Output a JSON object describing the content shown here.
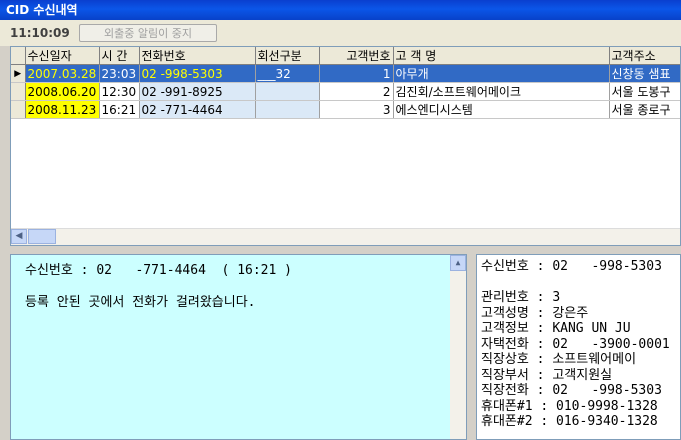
{
  "window": {
    "title": "CID 수신내역"
  },
  "toolbar": {
    "time": "11:10:09",
    "btn_label": "외출중 알림이 중지"
  },
  "grid": {
    "columns": [
      "수신일자",
      "시 간",
      "전화번호",
      "회선구분",
      "고객번호",
      "고 객 명",
      "고객주소"
    ],
    "rows": [
      {
        "date": "2007.03.28",
        "time": "23:03",
        "phone": "02   -998-5303",
        "line": "___32",
        "cust_no": "1",
        "name": "아무개",
        "address": "신창동 샘표"
      },
      {
        "date": "2008.06.20",
        "time": "12:30",
        "phone": "02   -991-8925",
        "line": "",
        "cust_no": "2",
        "name": "김진회/소프트웨어메이크",
        "address": "서울 도봉구"
      },
      {
        "date": "2008.11.23",
        "time": "16:21",
        "phone": "02   -771-4464",
        "line": "",
        "cust_no": "3",
        "name": "에스엔디시스템",
        "address": "서울 종로구"
      }
    ],
    "row_indicator": "▶"
  },
  "left_pane": {
    "line1": "수신번호 : 02   -771-4464  ( 16:21 )",
    "line2": "등록 안된 곳에서 전화가 걸려왔습니다."
  },
  "right_pane": {
    "header": "수신번호 : 02   -998-5303",
    "lines": [
      "관리번호 : 3",
      "고객성명 : 강은주",
      "고객정보 : KANG UN JU",
      "자택전화 : 02   -3900-0001",
      "직장상호 : 소프트웨어메이",
      "직장부서 : 고객지원실",
      "직장전화 : 02   -998-5303",
      "휴대폰#1 : 010-9998-1328",
      "휴대폰#2 : 016-9340-1328"
    ]
  }
}
